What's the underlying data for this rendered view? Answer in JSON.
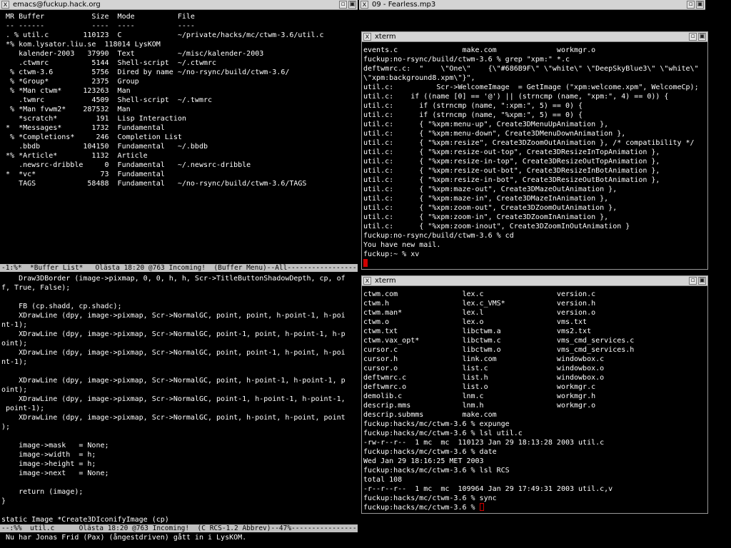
{
  "emacs": {
    "title": "emacs@fuckup.hack.org",
    "buffer_list": [
      " MR Buffer           Size  Mode          File",
      " -- ------           ----  ----          ----",
      " . % util.c        110123  C             ~/private/hacks/mc/ctwm-3.6/util.c",
      " *% kom.lysator.liu.se  118014 LysKOM",
      "    kalender-2003   37990  Text          ~/misc/kalender-2003",
      "    .ctwmrc          5144  Shell-script  ~/.ctwmrc",
      "  % ctwm-3.6         5756  Dired by name ~/no-rsync/build/ctwm-3.6/",
      "  % *Group*          2375  Group",
      "  % *Man ctwm*     123263  Man",
      "    .twmrc           4509  Shell-script  ~/.twmrc",
      "  % *Man fvwm2*    287532  Man",
      "    *scratch*         191  Lisp Interaction",
      " *  *Messages*       1732  Fundamental",
      "  % *Completions*     246  Completion List",
      "    .bbdb          104150  Fundamental   ~/.bbdb",
      " *% *Article*        1132  Article",
      "    .newsrc-dribble     0  Fundamental   ~/.newsrc-dribble",
      " *  *vc*               73  Fundamental",
      "    TAGS            58488  Fundamental   ~/no-rsync/build/ctwm-3.6/TAGS"
    ],
    "modeline_top": "-1:%*  *Buffer List*   Olästa 18:20 @763 Incoming!  (Buffer Menu)--All-----------------------------------",
    "code_lines": [
      "    Draw3DBorder (image->pixmap, 0, 0, h, h, Scr->TitleButtonShadowDepth, cp, of",
      "f, True, False);",
      "",
      "    FB (cp.shadd, cp.shadc);",
      "    XDrawLine (dpy, image->pixmap, Scr->NormalGC, point, point, h-point-1, h-poi",
      "nt-1);",
      "    XDrawLine (dpy, image->pixmap, Scr->NormalGC, point-1, point, h-point-1, h-p",
      "oint);",
      "    XDrawLine (dpy, image->pixmap, Scr->NormalGC, point, point-1, h-point, h-poi",
      "nt-1);",
      "",
      "    XDrawLine (dpy, image->pixmap, Scr->NormalGC, point, h-point-1, h-point-1, p",
      "oint);",
      "    XDrawLine (dpy, image->pixmap, Scr->NormalGC, point-1, h-point-1, h-point-1,",
      " point-1);",
      "    XDrawLine (dpy, image->pixmap, Scr->NormalGC, point, h-point, h-point, point",
      ");",
      "",
      "    image->mask   = None;",
      "    image->width  = h;",
      "    image->height = h;",
      "    image->next   = None;",
      "",
      "    return (image);",
      "}",
      "",
      "static Image *Create3DIconifyImage (cp)"
    ],
    "modeline_bottom": "--:%%  util.c      Olästa 18:20 @763 Incoming!  (C RCS-1.2 Abbrev)--47%-----------------------------",
    "minibuffer": " Nu har Jonas Frid (Pax) (ångestdriven) gått in i LysKOM."
  },
  "mp3": {
    "title": "09 - Fearless.mp3"
  },
  "xterm1": {
    "title": "xterm",
    "lines": [
      "events.c               make.com              workmgr.o",
      "fuckup:no-rsync/build/ctwm-3.6 % grep \"xpm:\" *.c",
      "deftwmrc.c:  \"    \\\"One\\\"    {\\\"#686B9F\\\" \\\"white\\\" \\\"DeepSkyBlue3\\\" \\\"white\\\"",
      "\\\"xpm:background8.xpm\\\"}\",",
      "util.c:          Scr->WelcomeImage  = GetImage (\"xpm:welcome.xpm\", WelcomeCp);",
      "util.c:    if ((name [0] == '@') || (strncmp (name, \"xpm:\", 4) == 0)) {",
      "util.c:      if (strncmp (name, \":xpm:\", 5) == 0) {",
      "util.c:      if (strncmp (name, \"%xpm:\", 5) == 0) {",
      "util.c:      { \"%xpm:menu-up\", Create3DMenuUpAnimation },",
      "util.c:      { \"%xpm:menu-down\", Create3DMenuDownAnimation },",
      "util.c:      { \"%xpm:resize\", Create3DZoomOutAnimation }, /* compatibility */",
      "util.c:      { \"%xpm:resize-out-top\", Create3DResizeInTopAnimation },",
      "util.c:      { \"%xpm:resize-in-top\", Create3DResizeOutTopAnimation },",
      "util.c:      { \"%xpm:resize-out-bot\", Create3DResizeInBotAnimation },",
      "util.c:      { \"%xpm:resize-in-bot\", Create3DResizeOutBotAnimation },",
      "util.c:      { \"%xpm:maze-out\", Create3DMazeOutAnimation },",
      "util.c:      { \"%xpm:maze-in\", Create3DMazeInAnimation },",
      "util.c:      { \"%xpm:zoom-out\", Create3DZoomOutAnimation },",
      "util.c:      { \"%xpm:zoom-in\", Create3DZoomInAnimation },",
      "util.c:      { \"%xpm:zoom-inout\", Create3DZoomInOutAnimation }",
      "fuckup:no-rsync/build/ctwm-3.6 % cd",
      "You have new mail.",
      "fuckup:~ % xv"
    ]
  },
  "xterm2": {
    "title": "xterm",
    "lines": [
      "ctwm.com               lex.c                 version.c",
      "ctwm.h                 lex.c_VMS*            version.h",
      "ctwm.man*              lex.l                 version.o",
      "ctwm.o                 lex.o                 vms.txt",
      "ctwm.txt               libctwm.a             vms2.txt",
      "ctwm.vax_opt*          libctwm.c             vms_cmd_services.c",
      "cursor.c               libctwm.o             vms_cmd_services.h",
      "cursor.h               link.com              windowbox.c",
      "cursor.o               list.c                windowbox.o",
      "deftwmrc.c             list.h                windowbox.o",
      "deftwmrc.o             list.o                workmgr.c",
      "demolib.c              lnm.c                 workmgr.h",
      "descrip.mms            lnm.h                 workmgr.o",
      "descrip.submms         make.com",
      "fuckup:hacks/mc/ctwm-3.6 % expunge",
      "fuckup:hacks/mc/ctwm-3.6 % lsl util.c",
      "-rw-r--r--  1 mc  mc  110123 Jan 29 18:13:28 2003 util.c",
      "fuckup:hacks/mc/ctwm-3.6 % date",
      "Wed Jan 29 18:16:25 MET 2003",
      "fuckup:hacks/mc/ctwm-3.6 % lsl RCS",
      "total 108",
      "-r--r--r--  1 mc  mc  109964 Jan 29 17:49:31 2003 util.c,v",
      "fuckup:hacks/mc/ctwm-3.6 % sync",
      "fuckup:hacks/mc/ctwm-3.6 % "
    ]
  },
  "icons": {
    "close": "x",
    "iconify": "▫",
    "zoom": "▣"
  },
  "colors": {
    "cursor": "#d00000",
    "titlebar": "#d4d4d4",
    "modeline": "#c0c0c0"
  }
}
